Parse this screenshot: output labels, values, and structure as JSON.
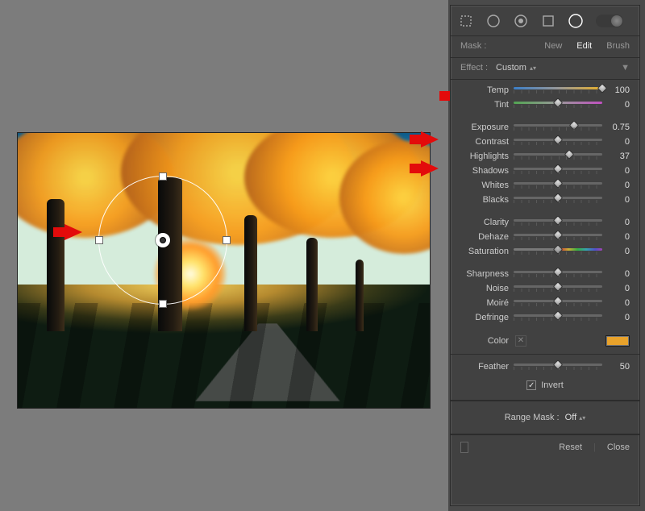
{
  "mask": {
    "label": "Mask :",
    "tabs": {
      "new": "New",
      "edit": "Edit",
      "brush": "Brush",
      "active": "edit"
    }
  },
  "effect": {
    "label": "Effect :",
    "preset": "Custom"
  },
  "tools": {
    "crop": "crop-icon",
    "spot": "spot-removal-icon",
    "redeye": "redeye-icon",
    "graduated": "graduated-filter-icon",
    "radial": "radial-filter-icon",
    "brush": "adjustment-brush-toggle"
  },
  "sliders": {
    "temp": {
      "label": "Temp",
      "value": 100,
      "pos": 100
    },
    "tint": {
      "label": "Tint",
      "value": 0,
      "pos": 50
    },
    "exposure": {
      "label": "Exposure",
      "value": 0.75,
      "pos": 68
    },
    "contrast": {
      "label": "Contrast",
      "value": 0,
      "pos": 50
    },
    "highlights": {
      "label": "Highlights",
      "value": 37,
      "pos": 63
    },
    "shadows": {
      "label": "Shadows",
      "value": 0,
      "pos": 50
    },
    "whites": {
      "label": "Whites",
      "value": 0,
      "pos": 50
    },
    "blacks": {
      "label": "Blacks",
      "value": 0,
      "pos": 50
    },
    "clarity": {
      "label": "Clarity",
      "value": 0,
      "pos": 50
    },
    "dehaze": {
      "label": "Dehaze",
      "value": 0,
      "pos": 50
    },
    "saturation": {
      "label": "Saturation",
      "value": 0,
      "pos": 50
    },
    "sharpness": {
      "label": "Sharpness",
      "value": 0,
      "pos": 50
    },
    "noise": {
      "label": "Noise",
      "value": 0,
      "pos": 50
    },
    "moire": {
      "label": "Moiré",
      "value": 0,
      "pos": 50
    },
    "defringe": {
      "label": "Defringe",
      "value": 0,
      "pos": 50
    },
    "feather": {
      "label": "Feather",
      "value": 50,
      "pos": 50
    }
  },
  "color": {
    "label": "Color",
    "swatch_hex": "#e8a22b"
  },
  "invert": {
    "label": "Invert",
    "checked": true
  },
  "range_mask": {
    "label": "Range Mask :",
    "value": "Off"
  },
  "footer": {
    "reset": "Reset",
    "close": "Close"
  }
}
